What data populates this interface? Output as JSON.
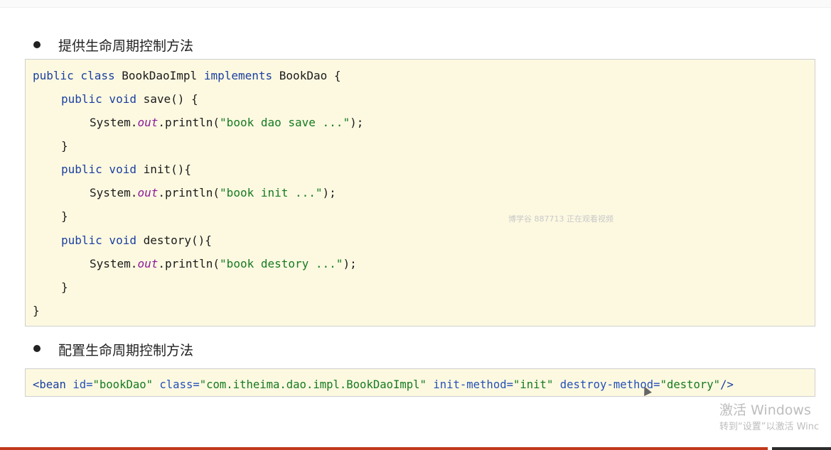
{
  "section1": {
    "heading": "提供生命周期控制方法",
    "code": {
      "l1": {
        "a": "public class",
        "b": " BookDaoImpl ",
        "c": "implements",
        "d": " BookDao {"
      },
      "l2": {
        "a": "public void",
        "b": " save() {"
      },
      "l3": {
        "a": "System.",
        "b": "out",
        "c": ".println(",
        "d": "\"book dao save ...\"",
        "e": ");"
      },
      "l4": {
        "a": "}"
      },
      "l5": {
        "a": "public void",
        "b": " init(){"
      },
      "l6": {
        "a": "System.",
        "b": "out",
        "c": ".println(",
        "d": "\"book init ...\"",
        "e": ");"
      },
      "l7": {
        "a": "}"
      },
      "l8": {
        "a": "public void",
        "b": " destory(){"
      },
      "l9": {
        "a": "System.",
        "b": "out",
        "c": ".println(",
        "d": "\"book destory ...\"",
        "e": ");"
      },
      "l10": {
        "a": "}"
      },
      "l11": {
        "a": "}"
      }
    }
  },
  "section2": {
    "heading": "配置生命周期控制方法",
    "xml": {
      "open": "<bean",
      "id_attr": " id=",
      "id_val": "\"bookDao\"",
      "class_attr": " class=",
      "class_val": "\"com.itheima.dao.impl.BookDaoImpl\"",
      "init_attr": " init-method=",
      "init_val": "\"init\"",
      "destroy_attr": " destroy-method=",
      "destroy_val": "\"destory\"",
      "close": "/>"
    }
  },
  "watermark": "博学谷 887713 正在观看视频",
  "activation": {
    "title": "激活 Windows",
    "subtitle": "转到“设置”以激活 Winc"
  },
  "colors": {
    "code_bg": "#fdf9e1",
    "keyword": "#1a3fa0",
    "string": "#157a1f",
    "field": "#8b1a9b",
    "bottom_bar": "#c0391b"
  }
}
